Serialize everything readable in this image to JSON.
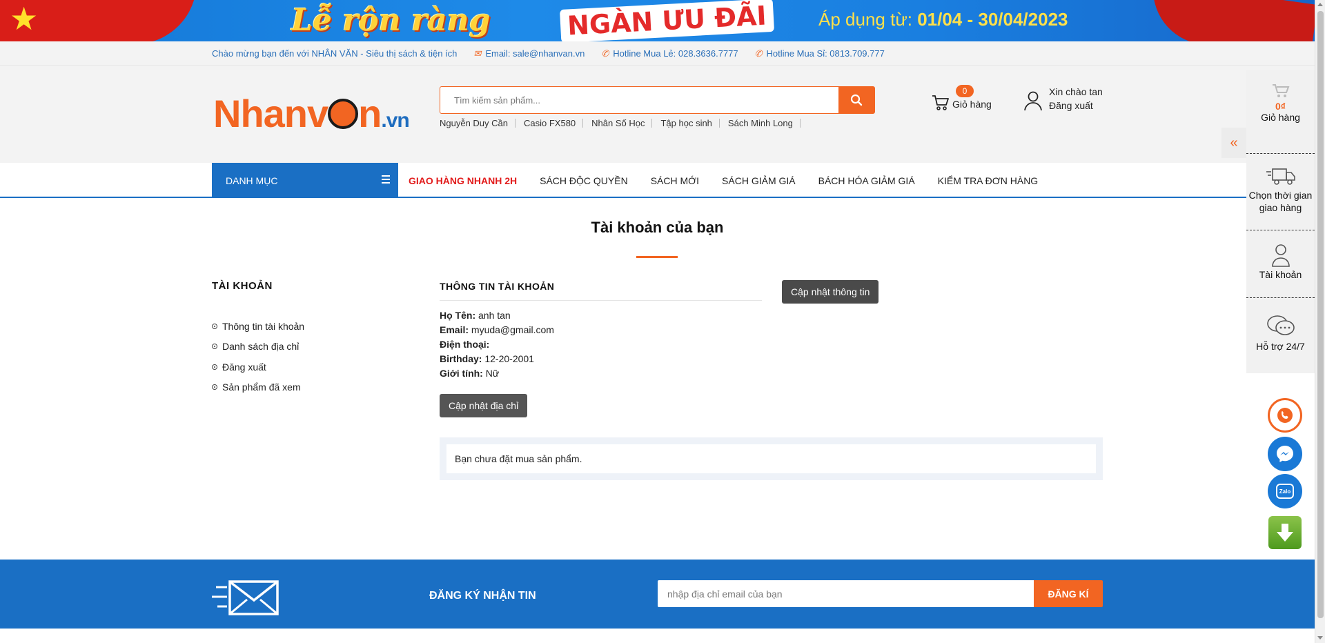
{
  "banner": {
    "title_script": "Lễ rộn ràng",
    "title_main": "NGÀN ƯU ĐÃI",
    "apply_prefix": "Áp dụng từ:",
    "apply_dates": "01/04 - 30/04/2023"
  },
  "topbar": {
    "welcome": "Chào mừng bạn đến với NHÂN VĂN - Siêu thị sách & tiện ích",
    "email": "Email: sale@nhanvan.vn",
    "hotline_retail": "Hotline Mua Lẻ: 028.3636.7777",
    "hotline_wholesale": "Hotline Mua Sỉ: 0813.709.777"
  },
  "header": {
    "logo_main": "Nhanv",
    "logo_after": "n",
    "logo_tld": ".vn",
    "search_placeholder": "Tìm kiếm sản phẩm...",
    "quick_links": [
      "Nguyễn Duy Cần",
      "Casio FX580",
      "Nhân Số Học",
      "Tập học sinh",
      "Sách Minh Long"
    ],
    "cart_count": "0",
    "cart_label": "Giỏ hàng",
    "greeting": "Xin chào tan",
    "logout": "Đăng xuất"
  },
  "nav": {
    "category": "DANH MỤC",
    "items": [
      "GIAO HÀNG NHANH 2H",
      "SÁCH ĐỘC QUYỀN",
      "SÁCH MỚI",
      "SÁCH GIẢM GIÁ",
      "BÁCH HÓA GIẢM GIÁ",
      "KIỂM TRA ĐƠN HÀNG"
    ]
  },
  "main": {
    "title": "Tài khoản của bạn",
    "sidebar_title": "TÀI KHOẢN",
    "sidebar_links": [
      "Thông tin tài khoản",
      "Danh sách địa chỉ",
      "Đăng xuất",
      "Sản phẩm đã xem"
    ],
    "info_title": "THÔNG TIN TÀI KHOẢN",
    "fields": {
      "name_label": "Họ Tên:",
      "name_value": "anh tan",
      "email_label": "Email:",
      "email_value": "myuda@gmail.com",
      "phone_label": "Điện thoại:",
      "phone_value": "",
      "birthday_label": "Birthday:",
      "birthday_value": "12-20-2001",
      "gender_label": "Giới tính:",
      "gender_value": "Nữ"
    },
    "update_info_button": "Cập nhật thông tin",
    "update_address_button": "Cập nhật địa chỉ",
    "no_orders": "Bạn chưa đặt mua sản phẩm."
  },
  "footer": {
    "newsletter_title": "ĐĂNG KÝ NHẬN TIN",
    "email_placeholder": "nhập địa chỉ email của bạn",
    "subscribe_button": "ĐĂNG KÍ"
  },
  "right_sidebar": {
    "cart_total": "0₫",
    "cart_label": "Giỏ hàng",
    "delivery_label": "Chọn thời gian giao hàng",
    "account_label": "Tài khoản",
    "support_label": "Hỗ trợ 24/7"
  },
  "colors": {
    "brand_orange": "#f26522",
    "brand_blue": "#1a6fc4",
    "nav_highlight_red": "#e21b1b"
  }
}
